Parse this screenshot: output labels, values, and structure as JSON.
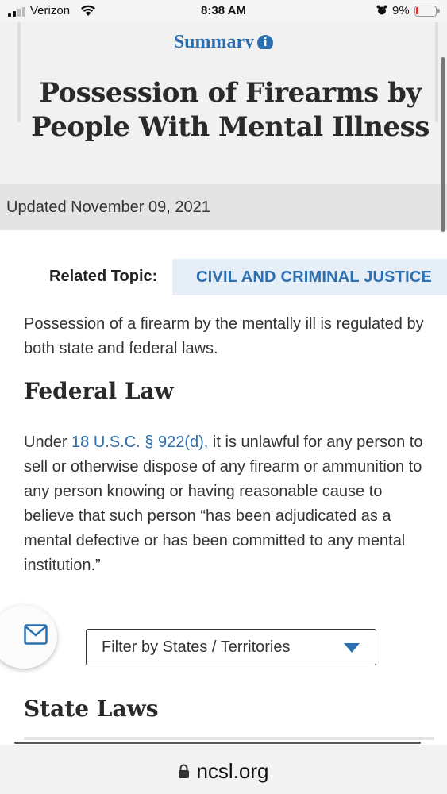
{
  "status_bar": {
    "carrier": "Verizon",
    "time": "8:38 AM",
    "battery_percent": "9%",
    "icons": [
      "signal-icon",
      "wifi-icon",
      "alarm-icon",
      "battery-icon"
    ]
  },
  "header": {
    "summary_link": "Summary",
    "summary_icon": "info-icon",
    "title": "Possession of Firearms by People With Mental Illness",
    "updated": "Updated November 09, 2021"
  },
  "related": {
    "label": "Related Topic:",
    "topic": "CIVIL AND CRIMINAL JUSTICE"
  },
  "content": {
    "intro": "Possession of a firearm by the mentally ill is regulated by both state and federal laws.",
    "federal_heading": "Federal Law",
    "federal_prefix": "Under ",
    "federal_link": "18 U.S.C. § 922(d),",
    "federal_body": " it is unlawful for any person to sell or otherwise dispose of any firearm or ammunition to any person knowing or having reasonable cause to believe that such person “has been adjudicated as a mental defective or has been committed to any mental institution.”",
    "state_heading": "State Laws"
  },
  "filter": {
    "label": "Filter by States / Territories",
    "icon": "caret-down-icon"
  },
  "email_button": {
    "icon": "envelope-icon"
  },
  "browser": {
    "url": "ncsl.org",
    "icon": "lock-icon"
  },
  "colors": {
    "link_blue": "#2b6fb0",
    "header_bg": "#f1f1f1",
    "topic_bg": "#e6eef8"
  }
}
